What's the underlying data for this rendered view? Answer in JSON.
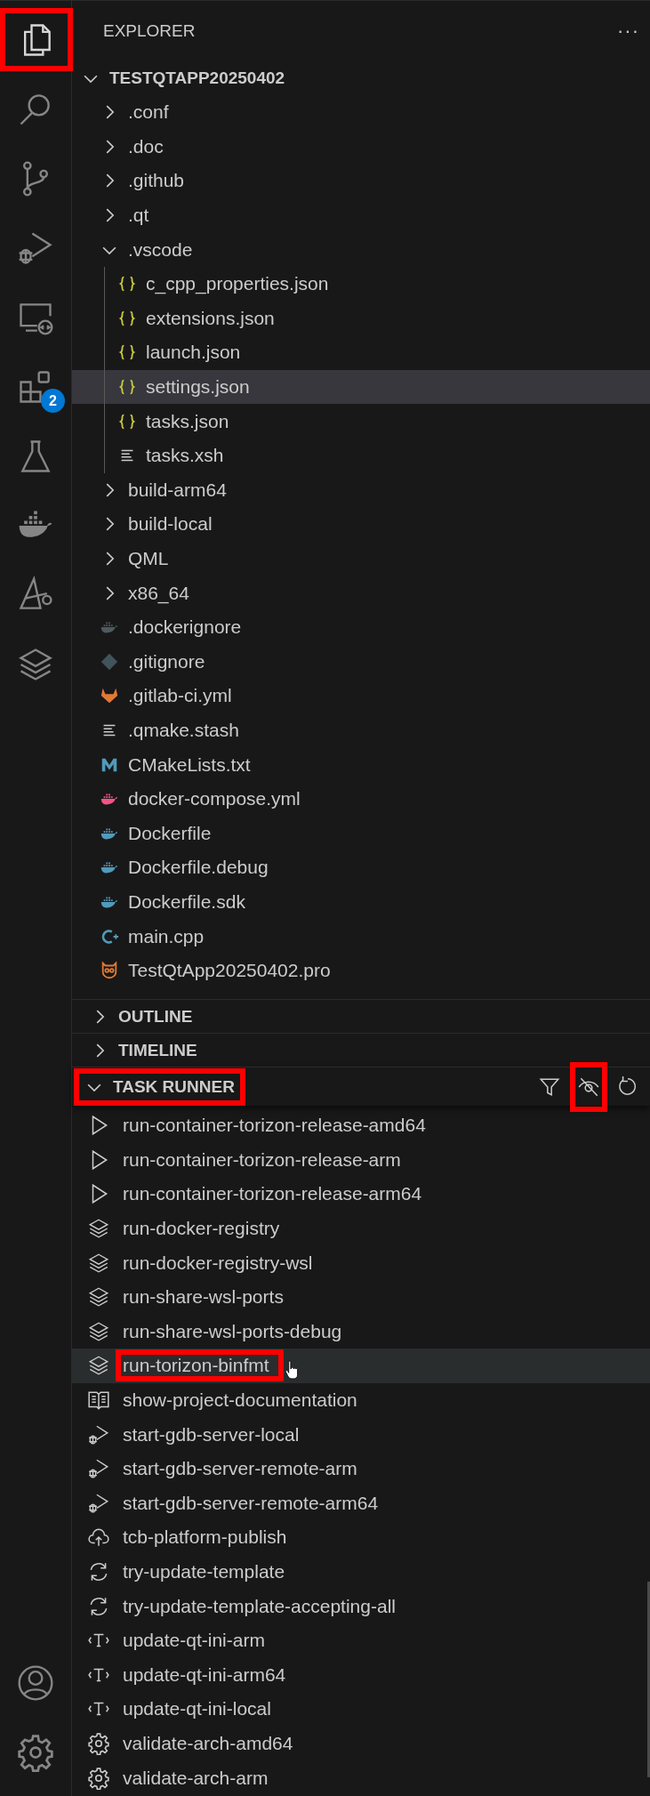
{
  "activity_bar": {
    "top": [
      {
        "kind": "files",
        "selected": true,
        "highlighted": true
      },
      {
        "kind": "search",
        "selected": false,
        "highlighted": false
      },
      {
        "kind": "branch",
        "selected": false,
        "highlighted": false
      },
      {
        "kind": "debug",
        "selected": false,
        "highlighted": false
      },
      {
        "kind": "remote",
        "selected": false,
        "highlighted": false
      },
      {
        "kind": "extensions",
        "selected": false,
        "highlighted": false,
        "badge": "2"
      },
      {
        "kind": "flask",
        "selected": false,
        "highlighted": false
      },
      {
        "kind": "whale",
        "selected": false,
        "highlighted": false
      },
      {
        "kind": "triangle",
        "selected": false,
        "highlighted": false
      },
      {
        "kind": "layers",
        "selected": false,
        "highlighted": false
      }
    ],
    "bottom": [
      {
        "kind": "account",
        "selected": false,
        "highlighted": false
      },
      {
        "kind": "gear",
        "selected": false,
        "highlighted": false
      }
    ]
  },
  "explorer": {
    "title": "EXPLORER",
    "more": "···",
    "root": {
      "label": "TESTQTAPP20250402",
      "expanded": true,
      "children": [
        {
          "kind": "folder",
          "label": ".conf",
          "expanded": false,
          "selected": false
        },
        {
          "kind": "folder",
          "label": ".doc",
          "expanded": false,
          "selected": false
        },
        {
          "kind": "folder",
          "label": ".github",
          "expanded": false,
          "selected": false
        },
        {
          "kind": "folder",
          "label": ".qt",
          "expanded": false,
          "selected": false
        },
        {
          "kind": "folder",
          "label": ".vscode",
          "expanded": true,
          "selected": false,
          "children": [
            {
              "kind": "json",
              "label": "c_cpp_properties.json",
              "selected": false
            },
            {
              "kind": "json",
              "label": "extensions.json",
              "selected": false
            },
            {
              "kind": "json",
              "label": "launch.json",
              "selected": false
            },
            {
              "kind": "json",
              "label": "settings.json",
              "selected": true
            },
            {
              "kind": "json",
              "label": "tasks.json",
              "selected": false
            },
            {
              "kind": "lines",
              "label": "tasks.xsh",
              "selected": false
            }
          ]
        },
        {
          "kind": "folder",
          "label": "build-arm64",
          "expanded": false,
          "selected": false
        },
        {
          "kind": "folder",
          "label": "build-local",
          "expanded": false,
          "selected": false
        },
        {
          "kind": "folder",
          "label": "QML",
          "expanded": false,
          "selected": false
        },
        {
          "kind": "folder",
          "label": "x86_64",
          "expanded": false,
          "selected": false
        },
        {
          "kind": "docker-grey",
          "label": ".dockerignore",
          "selected": false
        },
        {
          "kind": "git",
          "label": ".gitignore",
          "selected": false
        },
        {
          "kind": "gitlab",
          "label": ".gitlab-ci.yml",
          "selected": false
        },
        {
          "kind": "lines",
          "label": ".qmake.stash",
          "selected": false
        },
        {
          "kind": "cmake",
          "label": "CMakeLists.txt",
          "selected": false
        },
        {
          "kind": "docker-pink",
          "label": "docker-compose.yml",
          "selected": false
        },
        {
          "kind": "docker",
          "label": "Dockerfile",
          "selected": false
        },
        {
          "kind": "docker",
          "label": "Dockerfile.debug",
          "selected": false
        },
        {
          "kind": "docker",
          "label": "Dockerfile.sdk",
          "selected": false
        },
        {
          "kind": "cpp",
          "label": "main.cpp",
          "selected": false
        },
        {
          "kind": "qt",
          "label": "TestQtApp20250402.pro",
          "selected": false
        }
      ]
    }
  },
  "sections": [
    {
      "title": "OUTLINE",
      "expanded": false,
      "highlighted": false
    },
    {
      "title": "TIMELINE",
      "expanded": false,
      "highlighted": false
    }
  ],
  "task_runner": {
    "title": "TASK RUNNER",
    "expanded": true,
    "highlighted": true,
    "toolbar": [
      {
        "kind": "filter",
        "highlighted": false
      },
      {
        "kind": "eye-off",
        "highlighted": true
      },
      {
        "kind": "refresh",
        "highlighted": false
      }
    ],
    "tasks": [
      {
        "kind": "play",
        "label": "run-container-torizon-release-amd64",
        "hovered": false,
        "highlighted": false
      },
      {
        "kind": "play",
        "label": "run-container-torizon-release-arm",
        "hovered": false,
        "highlighted": false
      },
      {
        "kind": "play",
        "label": "run-container-torizon-release-arm64",
        "hovered": false,
        "highlighted": false
      },
      {
        "kind": "layers",
        "label": "run-docker-registry",
        "hovered": false,
        "highlighted": false
      },
      {
        "kind": "layers",
        "label": "run-docker-registry-wsl",
        "hovered": false,
        "highlighted": false
      },
      {
        "kind": "layers",
        "label": "run-share-wsl-ports",
        "hovered": false,
        "highlighted": false
      },
      {
        "kind": "layers",
        "label": "run-share-wsl-ports-debug",
        "hovered": false,
        "highlighted": false
      },
      {
        "kind": "layers",
        "label": "run-torizon-binfmt",
        "hovered": true,
        "highlighted": true
      },
      {
        "kind": "book",
        "label": "show-project-documentation",
        "hovered": false,
        "highlighted": false
      },
      {
        "kind": "debug",
        "label": "start-gdb-server-local",
        "hovered": false,
        "highlighted": false
      },
      {
        "kind": "debug",
        "label": "start-gdb-server-remote-arm",
        "hovered": false,
        "highlighted": false
      },
      {
        "kind": "debug",
        "label": "start-gdb-server-remote-arm64",
        "hovered": false,
        "highlighted": false
      },
      {
        "kind": "cloud",
        "label": "tcb-platform-publish",
        "hovered": false,
        "highlighted": false
      },
      {
        "kind": "sync",
        "label": "try-update-template",
        "hovered": false,
        "highlighted": false
      },
      {
        "kind": "sync",
        "label": "try-update-template-accepting-all",
        "hovered": false,
        "highlighted": false
      },
      {
        "kind": "tag",
        "label": "update-qt-ini-arm",
        "hovered": false,
        "highlighted": false
      },
      {
        "kind": "tag",
        "label": "update-qt-ini-arm64",
        "hovered": false,
        "highlighted": false
      },
      {
        "kind": "tag",
        "label": "update-qt-ini-local",
        "hovered": false,
        "highlighted": false
      },
      {
        "kind": "gear",
        "label": "validate-arch-amd64",
        "hovered": false,
        "highlighted": false
      },
      {
        "kind": "gear",
        "label": "validate-arch-arm",
        "hovered": false,
        "highlighted": false
      }
    ]
  }
}
